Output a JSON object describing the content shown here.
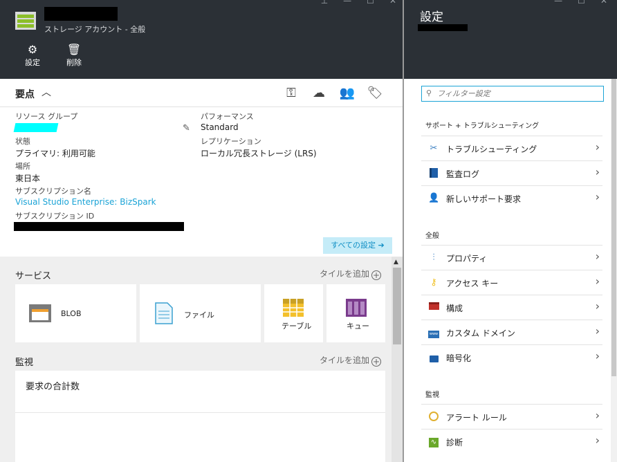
{
  "left_blade": {
    "subtitle": "ストレージ アカウント - 全般",
    "commands": {
      "settings_label": "設定",
      "delete_label": "削除"
    },
    "essentials": {
      "title": "要点",
      "properties": {
        "resource_group_label": "リソース グループ",
        "status_label": "状態",
        "status_value": "プライマリ: 利用可能",
        "location_label": "場所",
        "location_value": "東日本",
        "subscription_name_label": "サブスクリプション名",
        "subscription_name_value": "Visual Studio Enterprise: BizSpark",
        "subscription_id_label": "サブスクリプション ID",
        "performance_label": "パフォーマンス",
        "performance_value": "Standard",
        "replication_label": "レプリケーション",
        "replication_value": "ローカル冗長ストレージ (LRS)"
      },
      "all_settings_label": "すべての設定 ➔"
    },
    "services": {
      "title": "サービス",
      "add_tile_label": "タイルを追加",
      "tiles": [
        {
          "label": "BLOB"
        },
        {
          "label": "ファイル"
        },
        {
          "label": "テーブル"
        },
        {
          "label": "キュー"
        }
      ]
    },
    "monitoring": {
      "title": "監視",
      "add_tile_label": "タイルを追加",
      "chart_title": "要求の合計数"
    }
  },
  "right_blade": {
    "title": "設定",
    "filter_placeholder": "フィルター設定",
    "groups": [
      {
        "title": "サポート + トラブルシューティング",
        "items": [
          {
            "label": "トラブルシューティング",
            "icon": "wrench-icon"
          },
          {
            "label": "監査ログ",
            "icon": "audit-log-icon"
          },
          {
            "label": "新しいサポート要求",
            "icon": "support-person-icon"
          }
        ]
      },
      {
        "title": "全般",
        "items": [
          {
            "label": "プロパティ",
            "icon": "properties-icon"
          },
          {
            "label": "アクセス キー",
            "icon": "key-icon"
          },
          {
            "label": "構成",
            "icon": "toolbox-icon"
          },
          {
            "label": "カスタム ドメイン",
            "icon": "www-icon"
          },
          {
            "label": "暗号化",
            "icon": "lock-icon"
          }
        ]
      },
      {
        "title": "監視",
        "items": [
          {
            "label": "アラート ルール",
            "icon": "alert-gauge-icon"
          },
          {
            "label": "診断",
            "icon": "diagnostics-icon"
          }
        ]
      }
    ]
  },
  "colors": {
    "header_bg": "#2b3036",
    "accent": "#1aa3d6",
    "storage_green": "#8cbe2a",
    "redaction_black": "#000000",
    "redaction_cyan": "#00ffff"
  }
}
